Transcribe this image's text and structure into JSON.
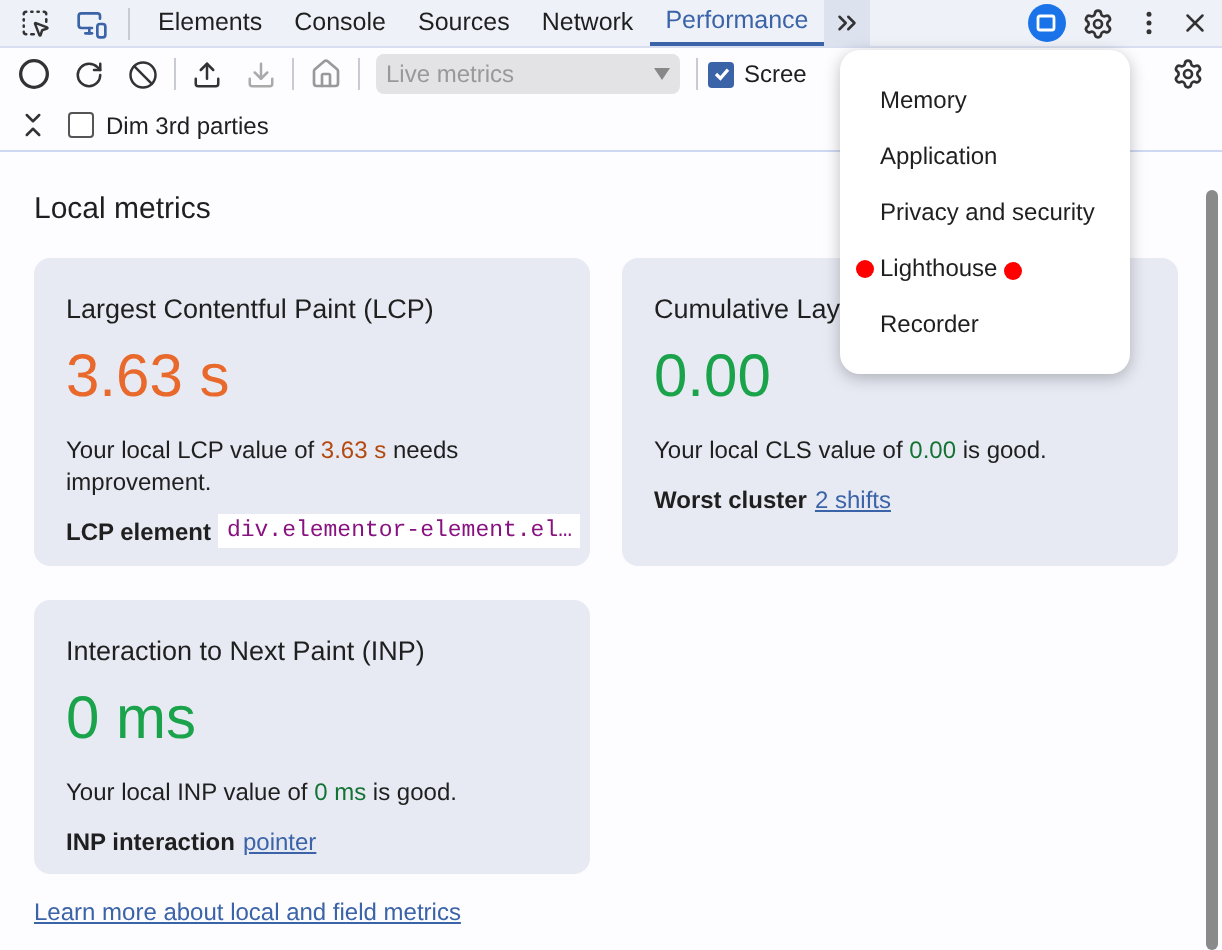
{
  "tabs": [
    {
      "label": "Elements",
      "selected": false
    },
    {
      "label": "Console",
      "selected": false
    },
    {
      "label": "Sources",
      "selected": false
    },
    {
      "label": "Network",
      "selected": false
    },
    {
      "label": "Performance",
      "selected": true
    }
  ],
  "toolbar": {
    "dropdown": "Live metrics",
    "screenshots": {
      "label": "Scree",
      "checked": true
    },
    "dim": {
      "label": "Dim 3rd parties",
      "checked": false
    }
  },
  "heading": "Local metrics",
  "cards": [
    {
      "title": "Largest Contentful Paint (LCP)",
      "value": "3.63 s",
      "kind": "average",
      "desc": [
        "Your local LCP value of ",
        "3.63 s",
        " needs improvement."
      ],
      "detail_label": "LCP element",
      "detail_code": "div.elementor-element.el…"
    },
    {
      "title": "Cumulative Lay",
      "value": "0.00",
      "kind": "good",
      "desc": [
        "Your local CLS value of ",
        "0.00",
        " is good."
      ],
      "detail_label": "Worst cluster",
      "detail_link": "2 shifts"
    },
    {
      "title": "Interaction to Next Paint (INP)",
      "value": "0 ms",
      "kind": "good",
      "desc": [
        "Your local INP value of ",
        "0 ms",
        " is good."
      ],
      "detail_label": "INP interaction",
      "detail_link": "pointer"
    }
  ],
  "learn_more": "Learn more about local and field metrics",
  "menu": [
    {
      "label": "Memory",
      "marked": false
    },
    {
      "label": "Application",
      "marked": false
    },
    {
      "label": "Privacy and security",
      "marked": false
    },
    {
      "label": "Lighthouse",
      "marked": true
    },
    {
      "label": "Recorder",
      "marked": false
    }
  ]
}
